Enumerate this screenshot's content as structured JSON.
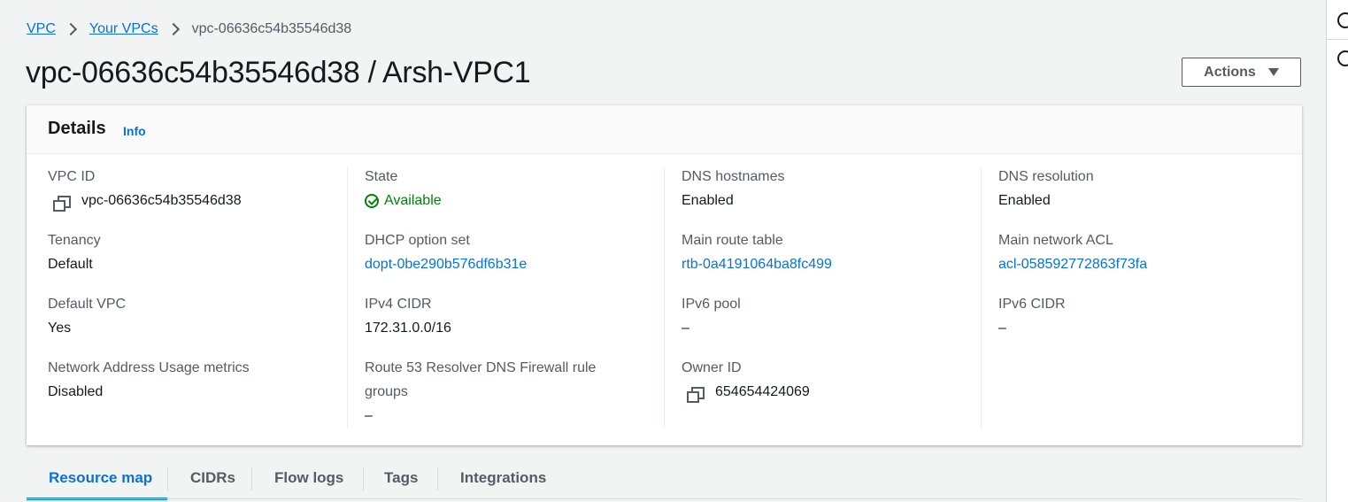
{
  "breadcrumb": {
    "items": [
      "VPC",
      "Your VPCs"
    ],
    "current": "vpc-06636c54b35546d38"
  },
  "header": {
    "title": "vpc-06636c54b35546d38 / Arsh-VPC1",
    "actions_label": "Actions"
  },
  "details": {
    "title": "Details",
    "info_label": "Info",
    "columns": [
      [
        {
          "label": "VPC ID",
          "value": "vpc-06636c54b35546d38",
          "copy": true
        },
        {
          "label": "Tenancy",
          "value": "Default"
        },
        {
          "label": "Default VPC",
          "value": "Yes"
        },
        {
          "label": "Network Address Usage metrics",
          "value": "Disabled"
        }
      ],
      [
        {
          "label": "State",
          "value": "Available",
          "status": "available"
        },
        {
          "label": "DHCP option set",
          "value": "dopt-0be290b576df6b31e",
          "link": true
        },
        {
          "label": "IPv4 CIDR",
          "value": "172.31.0.0/16"
        },
        {
          "label_line1": "Route 53 Resolver DNS Firewall rule",
          "label_line2": "groups",
          "value": "–"
        }
      ],
      [
        {
          "label": "DNS hostnames",
          "value": "Enabled"
        },
        {
          "label": "Main route table",
          "value": "rtb-0a4191064ba8fc499",
          "link": true
        },
        {
          "label": "IPv6 pool",
          "value": "–"
        },
        {
          "label": "Owner ID",
          "value": "654654424069",
          "copy": true
        }
      ],
      [
        {
          "label": "DNS resolution",
          "value": "Enabled"
        },
        {
          "label": "Main network ACL",
          "value": "acl-058592772863f73fa",
          "link": true
        },
        {
          "label": "IPv6 CIDR",
          "value": "–"
        }
      ]
    ]
  },
  "tabs": [
    {
      "label": "Resource map",
      "active": true
    },
    {
      "label": "CIDRs"
    },
    {
      "label": "Flow logs"
    },
    {
      "label": "Tags"
    },
    {
      "label": "Integrations"
    }
  ],
  "colors": {
    "link": "#0972d3",
    "success": "#037f0c",
    "text": "#16191f",
    "muted": "#545b64"
  },
  "icons": [
    "copy-icon",
    "check-circle-icon",
    "caret-down-icon",
    "chevron-right-icon",
    "info-circle-icon",
    "settings-icon"
  ]
}
